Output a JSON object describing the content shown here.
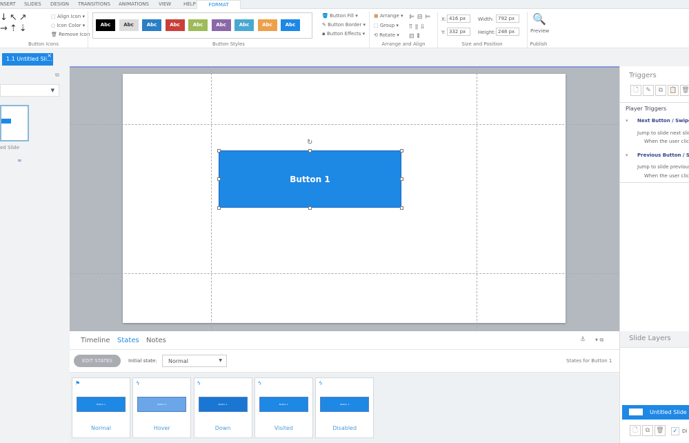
{
  "menu_tabs": [
    "NSERT",
    "SLIDES",
    "DESIGN",
    "TRANSITIONS",
    "ANIMATIONS",
    "VIEW",
    "HELP",
    "FORMAT"
  ],
  "ribbon": {
    "button_icons": {
      "label": "Button Icons",
      "align_icon": "Align Icon",
      "icon_color": "Icon Color",
      "remove_icon": "Remove Icon"
    },
    "button_styles": {
      "label": "Button Styles",
      "styles": [
        {
          "text": "Abc",
          "color": "#000000"
        },
        {
          "text": "Abc",
          "color": "#dcdcdc"
        },
        {
          "text": "Abc",
          "color": "#2a7ec4"
        },
        {
          "text": "Abc",
          "color": "#c9403a"
        },
        {
          "text": "Abc",
          "color": "#9dbb5a"
        },
        {
          "text": "Abc",
          "color": "#8a68a8"
        },
        {
          "text": "Abc",
          "color": "#4aa8d0"
        },
        {
          "text": "Abc",
          "color": "#eda04c"
        },
        {
          "text": "Abc",
          "color": "#1e88e5"
        }
      ],
      "fill": "Button Fill",
      "border": "Button Border",
      "effects": "Button Effects"
    },
    "arrange": {
      "label": "Arrange and Align",
      "arrange": "Arrange",
      "group": "Group",
      "rotate": "Rotate"
    },
    "size": {
      "label": "Size and Position",
      "x_label": "X:",
      "x": "416 px",
      "y_label": "Y:",
      "y": "332 px",
      "width_label": "Width:",
      "width": "792 px",
      "height_label": "Height:",
      "height": "248 px"
    },
    "publish": {
      "label": "Publish",
      "preview": "Preview"
    }
  },
  "doc_tab": "1.1 Untitled Sli...",
  "left_panel": {
    "slide_caption": "ed Slide"
  },
  "slide": {
    "button_text": "Button 1"
  },
  "bottom": {
    "tabs": [
      "Timeline",
      "States",
      "Notes"
    ],
    "active_tab": "States",
    "edit_states": "EDIT STATES",
    "initial_state_label": "Initial state:",
    "initial_state": "Normal",
    "states_for": "States for Button 1",
    "states": [
      {
        "name": "Normal",
        "icon": "flag-icon",
        "color": "#1e88e5"
      },
      {
        "name": "Hover",
        "icon": "lightning-icon",
        "color": "#6aa6e8"
      },
      {
        "name": "Down",
        "icon": "lightning-icon",
        "color": "#1976d2"
      },
      {
        "name": "Visited",
        "icon": "lightning-icon",
        "color": "#1e88e5"
      },
      {
        "name": "Disabled",
        "icon": "lightning-icon",
        "color": "#1e88e5"
      }
    ]
  },
  "triggers": {
    "title": "Triggers",
    "section": "Player Triggers",
    "items": [
      {
        "name": "Next Button / Swipe l",
        "action": "Jump to slide next slide",
        "when": "When the user clicks"
      },
      {
        "name": "Previous Button / Swi",
        "action": "Jump to slide previous",
        "when": "When the user clicks"
      }
    ]
  },
  "layers": {
    "title": "Slide Layers",
    "item": "Untitled Slide",
    "checkbox_label": "Di"
  }
}
